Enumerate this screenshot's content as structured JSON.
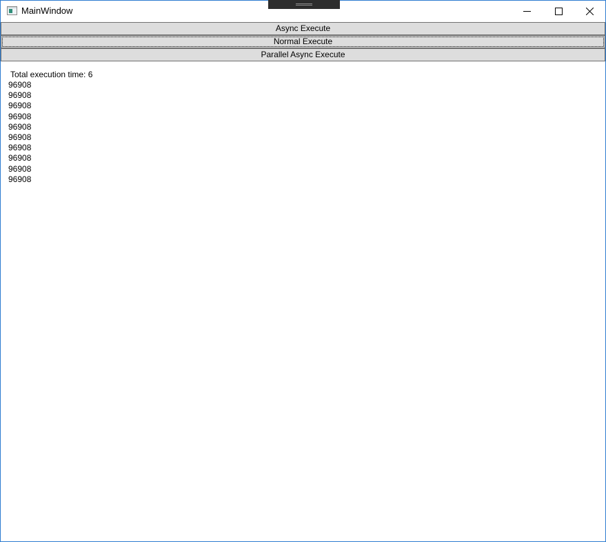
{
  "window": {
    "title": "MainWindow",
    "icon": "app-window-icon"
  },
  "caption_buttons": {
    "minimize_icon": "minimize-icon",
    "maximize_icon": "maximize-icon",
    "close_icon": "close-icon"
  },
  "buttons": {
    "async_execute": "Async Execute",
    "normal_execute": "Normal Execute",
    "parallel_async_execute": "Parallel Async Execute"
  },
  "output": {
    "total_line": "Total execution time: 6",
    "results": [
      "96908",
      "96908",
      "96908",
      "96908",
      "96908",
      "96908",
      "96908",
      "96908",
      "96908",
      "96908"
    ]
  },
  "colors": {
    "window_border": "#2b7bd0",
    "button_face": "#dddddd",
    "button_border": "#707070",
    "drag_handle": "#2d2d2d"
  }
}
